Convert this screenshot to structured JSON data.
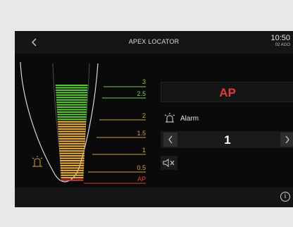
{
  "header": {
    "title": "APEX LOCATOR",
    "time": "10:50",
    "date": "02 AGO"
  },
  "scale": {
    "labels": [
      "3",
      "2.5",
      "2",
      "1.5",
      "1",
      "0.5",
      "AP"
    ]
  },
  "readout": {
    "value": "AP",
    "color": "#e03a3a"
  },
  "alarm": {
    "label": "Alarm",
    "value": "1"
  },
  "colors": {
    "green": "#5ccb3a",
    "yellow": "#f0b23c",
    "red": "#e03a3a",
    "background": "#0a0a0a"
  }
}
